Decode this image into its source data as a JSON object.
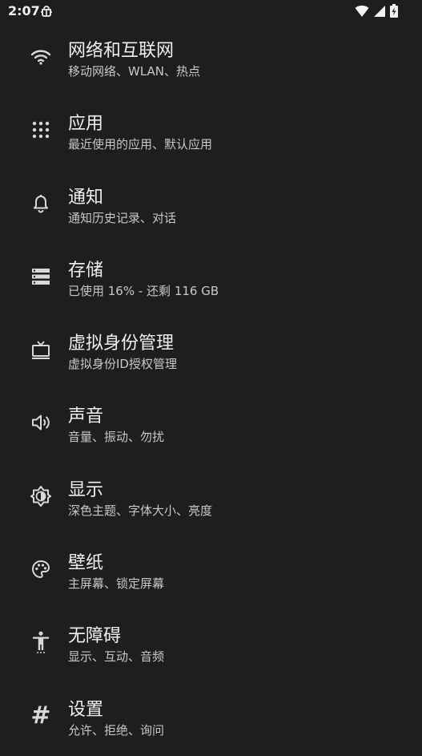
{
  "status_bar": {
    "time": "2:07",
    "debug_icon": "bug-icon",
    "wifi_icon": "wifi-icon",
    "signal_icon": "signal-icon",
    "battery_icon": "battery-charging-icon"
  },
  "settings": {
    "items": [
      {
        "icon": "wifi-icon",
        "title": "网络和互联网",
        "subtitle": "移动网络、WLAN、热点"
      },
      {
        "icon": "apps-grid-icon",
        "title": "应用",
        "subtitle": "最近使用的应用、默认应用"
      },
      {
        "icon": "bell-icon",
        "title": "通知",
        "subtitle": "通知历史记录、对话"
      },
      {
        "icon": "storage-icon",
        "title": "存储",
        "subtitle": "已使用 16% - 还剩 116 GB"
      },
      {
        "icon": "tv-icon",
        "title": "虚拟身份管理",
        "subtitle": "虚拟身份ID授权管理"
      },
      {
        "icon": "volume-icon",
        "title": "声音",
        "subtitle": "音量、振动、勿扰"
      },
      {
        "icon": "brightness-icon",
        "title": "显示",
        "subtitle": "深色主题、字体大小、亮度"
      },
      {
        "icon": "palette-icon",
        "title": "壁纸",
        "subtitle": "主屏幕、锁定屏幕"
      },
      {
        "icon": "accessibility-icon",
        "title": "无障碍",
        "subtitle": "显示、互动、音频"
      },
      {
        "icon": "hash-icon",
        "title": "设置",
        "subtitle": "允许、拒绝、询问"
      }
    ]
  }
}
